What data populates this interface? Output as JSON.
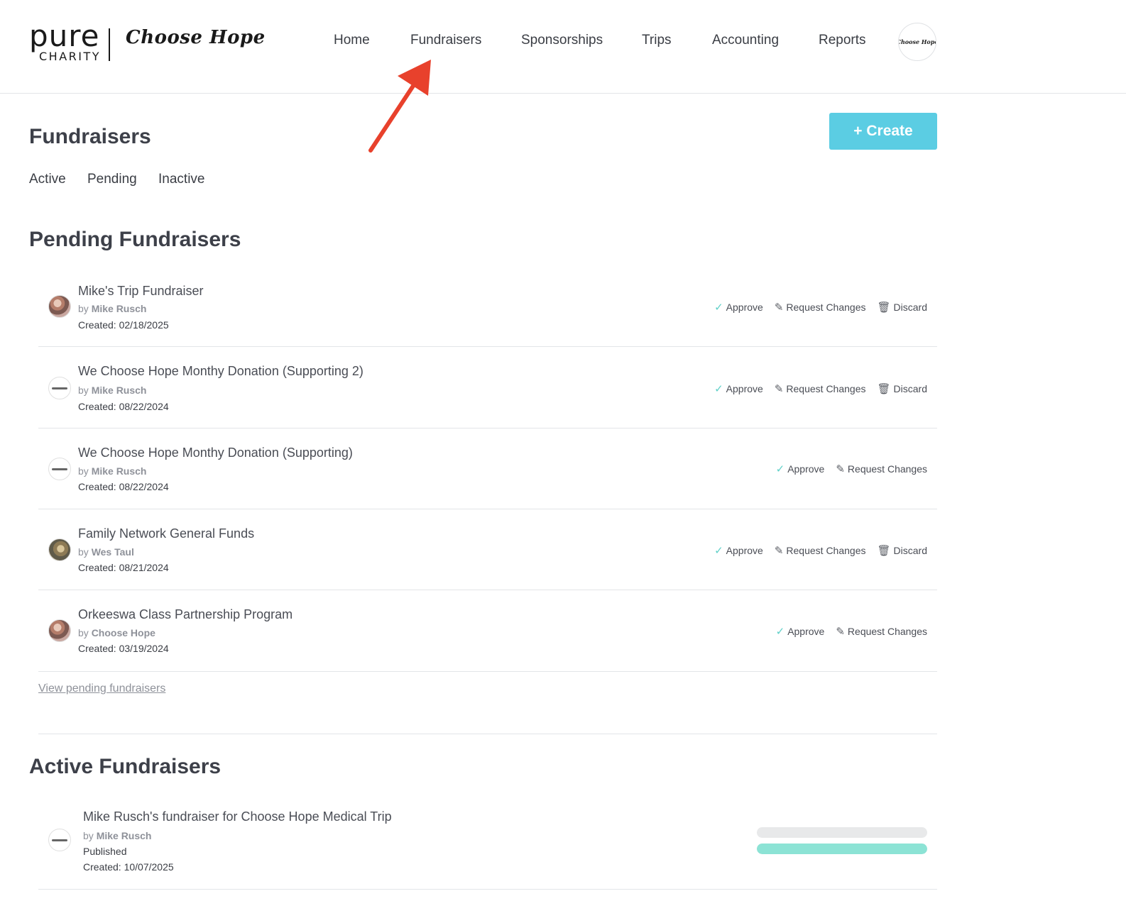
{
  "header": {
    "logo": {
      "pure": "pure",
      "charity": "CHARITY",
      "org": "Choose Hope"
    },
    "nav": [
      {
        "label": "Home"
      },
      {
        "label": "Fundraisers"
      },
      {
        "label": "Sponsorships"
      },
      {
        "label": "Trips"
      },
      {
        "label": "Accounting"
      },
      {
        "label": "Reports"
      }
    ],
    "avatar_text": "Choose Hope"
  },
  "page": {
    "title": "Fundraisers",
    "create_label": "+ Create",
    "tabs": [
      {
        "label": "Active"
      },
      {
        "label": "Pending"
      },
      {
        "label": "Inactive"
      }
    ]
  },
  "pending": {
    "title": "Pending Fundraisers",
    "view_link": "View pending fundraisers",
    "actions": {
      "approve": "Approve",
      "request": "Request Changes",
      "discard": "Discard"
    },
    "by_prefix": "by",
    "items": [
      {
        "title": "Mike's Trip Fundraiser",
        "author": "Mike Rusch",
        "created": "Created: 02/18/2025",
        "avatar": "photo",
        "discard": true
      },
      {
        "title": "We Choose Hope Monthy Donation (Supporting 2)",
        "author": "Mike Rusch",
        "created": "Created: 08/22/2024",
        "avatar": "logo",
        "discard": true
      },
      {
        "title": "We Choose Hope Monthy Donation (Supporting)",
        "author": "Mike Rusch",
        "created": "Created: 08/22/2024",
        "avatar": "logo",
        "discard": false
      },
      {
        "title": "Family Network General Funds",
        "author": "Wes Taul",
        "created": "Created: 08/21/2024",
        "avatar": "photo2",
        "discard": true
      },
      {
        "title": "Orkeeswa Class Partnership Program",
        "author": "Choose Hope",
        "created": "Created: 03/19/2024",
        "avatar": "photo",
        "discard": false
      }
    ]
  },
  "active": {
    "title": "Active Fundraisers",
    "items": [
      {
        "title": "Mike Rusch's fundraiser for Choose Hope Medical Trip",
        "author": "Mike Rusch",
        "status": "Published",
        "created": "Created: 10/07/2025",
        "progress": 1.0
      }
    ]
  },
  "colors": {
    "accent": "#5bcde3",
    "check": "#5fd0c8",
    "progress": "#8ce3d5",
    "arrow": "#e8412c"
  }
}
